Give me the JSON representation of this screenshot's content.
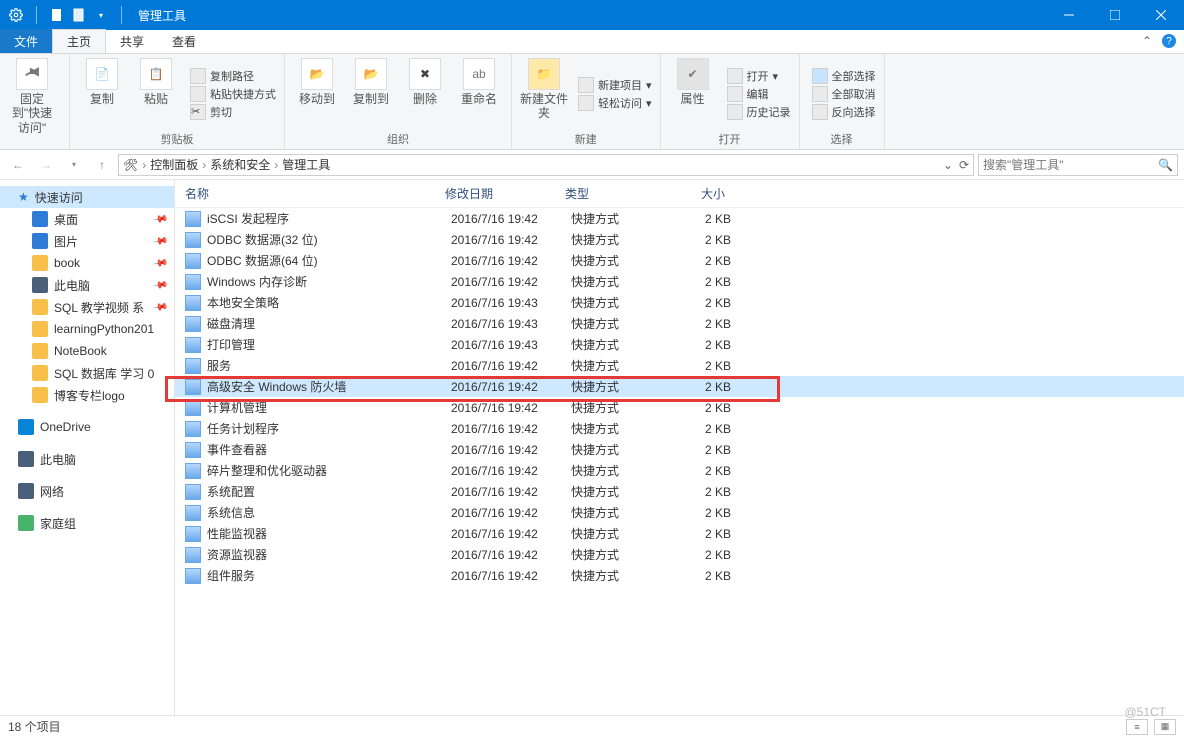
{
  "titlebar": {
    "title": "管理工具"
  },
  "tabs": {
    "file": "文件",
    "home": "主页",
    "share": "共享",
    "view": "查看"
  },
  "ribbon": {
    "pin": "固定到\"快速访问\"",
    "copy": "复制",
    "paste": "粘贴",
    "clip": {
      "copypath": "复制路径",
      "pasteshortcut": "粘贴快捷方式",
      "cut": "剪切"
    },
    "g_clipboard": "剪贴板",
    "moveto": "移动到",
    "copyto": "复制到",
    "delete": "删除",
    "rename": "重命名",
    "g_organize": "组织",
    "newfolder": "新建文件夹",
    "newitem": "新建项目",
    "easyaccess": "轻松访问",
    "g_new": "新建",
    "properties": "属性",
    "open": "打开",
    "edit": "编辑",
    "history": "历史记录",
    "g_open": "打开",
    "selectall": "全部选择",
    "selectnone": "全部取消",
    "invert": "反向选择",
    "g_select": "选择"
  },
  "breadcrumbs": [
    "控制面板",
    "系统和安全",
    "管理工具"
  ],
  "search": {
    "placeholder": "搜索\"管理工具\""
  },
  "sidebar": {
    "quick": "快速访问",
    "items": [
      {
        "label": "桌面",
        "color": "#2e7cd6",
        "pin": true
      },
      {
        "label": "图片",
        "color": "#2e7cd6",
        "pin": true
      },
      {
        "label": "book",
        "color": "#f7c04a",
        "pin": true
      },
      {
        "label": "此电脑",
        "color": "#4b5e7a",
        "pin": true
      },
      {
        "label": "SQL 教学视频 系",
        "color": "#f7c04a",
        "pin": true
      },
      {
        "label": "learningPython201",
        "color": "#f7c04a",
        "pin": false
      },
      {
        "label": "NoteBook",
        "color": "#f7c04a",
        "pin": false
      },
      {
        "label": "SQL 数据库 学习 0",
        "color": "#f7c04a",
        "pin": false
      },
      {
        "label": "博客专栏logo",
        "color": "#f7c04a",
        "pin": false
      }
    ],
    "onedrive": "OneDrive",
    "thispc": "此电脑",
    "network": "网络",
    "homegroup": "家庭组"
  },
  "columns": {
    "name": "名称",
    "date": "修改日期",
    "type": "类型",
    "size": "大小"
  },
  "files": [
    {
      "name": "iSCSI 发起程序",
      "date": "2016/7/16 19:42",
      "type": "快捷方式",
      "size": "2 KB",
      "sel": false
    },
    {
      "name": "ODBC 数据源(32 位)",
      "date": "2016/7/16 19:42",
      "type": "快捷方式",
      "size": "2 KB",
      "sel": false
    },
    {
      "name": "ODBC 数据源(64 位)",
      "date": "2016/7/16 19:42",
      "type": "快捷方式",
      "size": "2 KB",
      "sel": false
    },
    {
      "name": "Windows 内存诊断",
      "date": "2016/7/16 19:42",
      "type": "快捷方式",
      "size": "2 KB",
      "sel": false
    },
    {
      "name": "本地安全策略",
      "date": "2016/7/16 19:43",
      "type": "快捷方式",
      "size": "2 KB",
      "sel": false
    },
    {
      "name": "磁盘清理",
      "date": "2016/7/16 19:43",
      "type": "快捷方式",
      "size": "2 KB",
      "sel": false
    },
    {
      "name": "打印管理",
      "date": "2016/7/16 19:43",
      "type": "快捷方式",
      "size": "2 KB",
      "sel": false
    },
    {
      "name": "服务",
      "date": "2016/7/16 19:42",
      "type": "快捷方式",
      "size": "2 KB",
      "sel": false
    },
    {
      "name": "高级安全 Windows 防火墙",
      "date": "2016/7/16 19:42",
      "type": "快捷方式",
      "size": "2 KB",
      "sel": true
    },
    {
      "name": "计算机管理",
      "date": "2016/7/16 19:42",
      "type": "快捷方式",
      "size": "2 KB",
      "sel": false
    },
    {
      "name": "任务计划程序",
      "date": "2016/7/16 19:42",
      "type": "快捷方式",
      "size": "2 KB",
      "sel": false
    },
    {
      "name": "事件查看器",
      "date": "2016/7/16 19:42",
      "type": "快捷方式",
      "size": "2 KB",
      "sel": false
    },
    {
      "name": "碎片整理和优化驱动器",
      "date": "2016/7/16 19:42",
      "type": "快捷方式",
      "size": "2 KB",
      "sel": false
    },
    {
      "name": "系统配置",
      "date": "2016/7/16 19:42",
      "type": "快捷方式",
      "size": "2 KB",
      "sel": false
    },
    {
      "name": "系统信息",
      "date": "2016/7/16 19:42",
      "type": "快捷方式",
      "size": "2 KB",
      "sel": false
    },
    {
      "name": "性能监视器",
      "date": "2016/7/16 19:42",
      "type": "快捷方式",
      "size": "2 KB",
      "sel": false
    },
    {
      "name": "资源监视器",
      "date": "2016/7/16 19:42",
      "type": "快捷方式",
      "size": "2 KB",
      "sel": false
    },
    {
      "name": "组件服务",
      "date": "2016/7/16 19:42",
      "type": "快捷方式",
      "size": "2 KB",
      "sel": false
    }
  ],
  "status": {
    "count": "18 个项目"
  },
  "watermark": "@51CT"
}
